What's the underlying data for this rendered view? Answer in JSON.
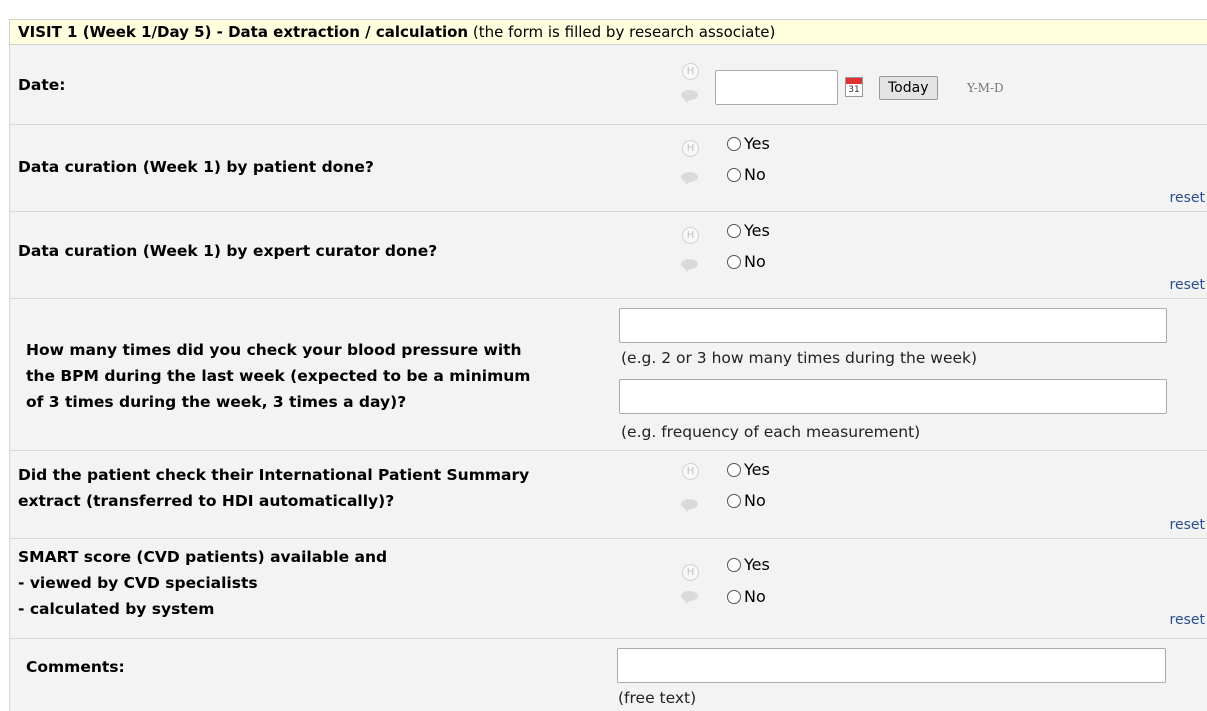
{
  "header": {
    "title": "VISIT 1 (Week 1/Day 5) - Data extraction / calculation",
    "subtitle": "(the form is filled by research associate)"
  },
  "icons": {
    "history": "H",
    "comment": "comment-icon"
  },
  "date_field": {
    "label": "Date:",
    "value": "",
    "calendar_day": "31",
    "today_label": "Today",
    "format": "Y-M-D"
  },
  "q1": {
    "label": "Data curation (Week 1) by patient done?",
    "yes": "Yes",
    "no": "No",
    "reset": "reset"
  },
  "q2": {
    "label": "Data curation (Week 1) by expert curator done?",
    "yes": "Yes",
    "no": "No",
    "reset": "reset"
  },
  "q3": {
    "label": "How many times did you check your blood pressure with\nthe BPM during the last week (expected to be a minimum\nof 3 times during the week, 3 times a day)?",
    "input1_value": "",
    "hint1": "(e.g. 2 or 3 how many times during the week)",
    "input2_value": "",
    "hint2": "(e.g. frequency of each measurement)"
  },
  "q4": {
    "label": "Did the patient check their International Patient Summary\nextract (transferred to HDI automatically)?",
    "yes": "Yes",
    "no": "No",
    "reset": "reset"
  },
  "q5": {
    "label": "SMART score (CVD patients) available and\n- viewed by CVD specialists\n- calculated by system",
    "yes": "Yes",
    "no": "No",
    "reset": "reset"
  },
  "comments": {
    "label": "Comments:",
    "value": "",
    "hint": "(free text)"
  }
}
